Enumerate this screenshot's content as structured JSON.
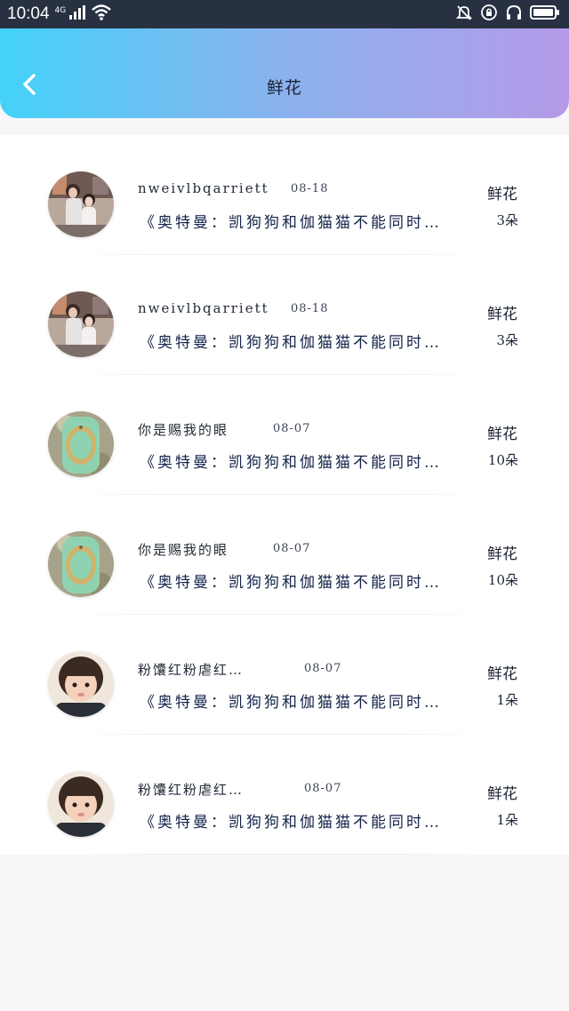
{
  "status_bar": {
    "time": "10:04",
    "network": "4G"
  },
  "header": {
    "title": "鲜花"
  },
  "records": [
    {
      "user": "nweivlbqarriett",
      "date": "08-18",
      "gift": "鲜花",
      "message": "《奥特曼：凯狗狗和伽猫猫不能同时…",
      "count": "3朵",
      "avatar": "avatar-a"
    },
    {
      "user": "nweivlbqarriett",
      "date": "08-18",
      "gift": "鲜花",
      "message": "《奥特曼：凯狗狗和伽猫猫不能同时…",
      "count": "3朵",
      "avatar": "avatar-a"
    },
    {
      "user": "你是赐我的眼",
      "date": "08-07",
      "gift": "鲜花",
      "message": "《奥特曼：凯狗狗和伽猫猫不能同时…",
      "count": "10朵",
      "avatar": "avatar-b"
    },
    {
      "user": "你是赐我的眼",
      "date": "08-07",
      "gift": "鲜花",
      "message": "《奥特曼：凯狗狗和伽猫猫不能同时…",
      "count": "10朵",
      "avatar": "avatar-b"
    },
    {
      "user": "粉馕红粉虐红…",
      "date": "08-07",
      "gift": "鲜花",
      "message": "《奥特曼：凯狗狗和伽猫猫不能同时…",
      "count": "1朵",
      "avatar": "avatar-c"
    },
    {
      "user": "粉馕红粉虐红…",
      "date": "08-07",
      "gift": "鲜花",
      "message": "《奥特曼：凯狗狗和伽猫猫不能同时…",
      "count": "1朵",
      "avatar": "avatar-c"
    }
  ],
  "colors": {
    "header_gradient_start": "#43d2f8",
    "header_gradient_end": "#b59ae8",
    "status_bar": "#273142"
  }
}
